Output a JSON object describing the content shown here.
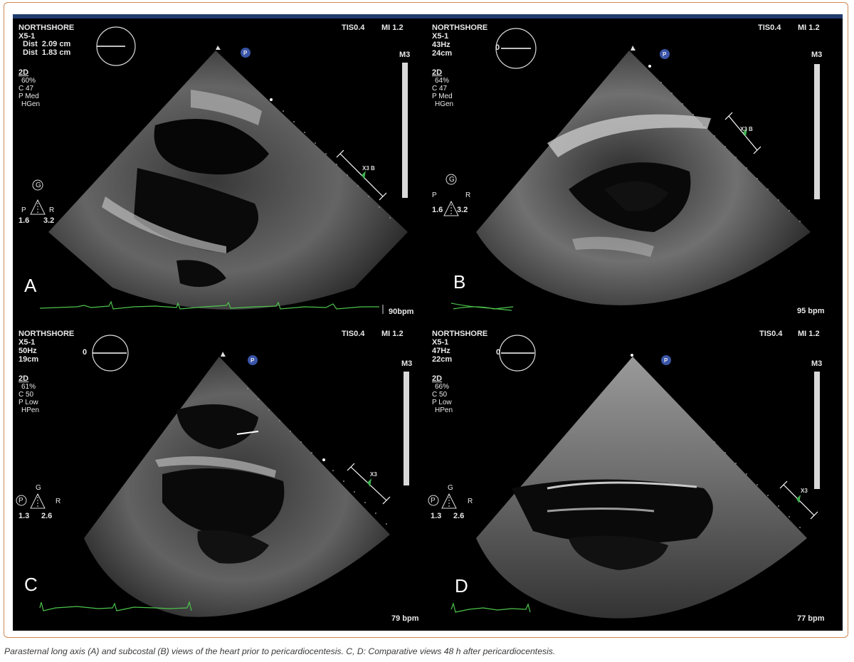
{
  "caption": "Parasternal long axis (A) and subcostal (B) views of the heart prior to pericardiocentesis. C, D: Comparative views 48 h after pericardiocentesis.",
  "colors": {
    "frame_border": "#d08a52",
    "top_bar": "#1f3c6c",
    "ecg_trace": "#4cc44c",
    "marker_green": "#3fb34f",
    "probe_badge": "#3a55a8"
  },
  "panels": {
    "A": {
      "letter": "A",
      "site": "NORTHSHORE",
      "probe": "X5-1",
      "dist1": "Dist  2.09 cm",
      "dist2": "Dist  1.83 cm",
      "mode": "2D",
      "gain": "60%",
      "comp": "C 47",
      "power": "P Med",
      "harmonic": "HGen",
      "tis": "TIS0.4",
      "mi": "MI 1.2",
      "map": "M3",
      "probe_badge": "P",
      "g_label": "G",
      "p_label": "P",
      "r_label": "R",
      "g_left": "1.6",
      "g_right": "3.2",
      "bpm": "90bpm",
      "depth_marker": "X3 B"
    },
    "B": {
      "letter": "B",
      "site": "NORTHSHORE",
      "probe": "X5-1",
      "freq": "43Hz",
      "depth": "24cm",
      "angle": "0",
      "mode": "2D",
      "gain": "64%",
      "comp": "C 47",
      "power": "P Med",
      "harmonic": "HGen",
      "tis": "TIS0.4",
      "mi": "MI 1.2",
      "map": "M3",
      "probe_badge": "P",
      "g_label": "G",
      "p_label": "P",
      "r_label": "R",
      "g_left": "1.6",
      "g_right": "3.2",
      "bpm": "95 bpm",
      "depth_marker": "X3 B"
    },
    "C": {
      "letter": "C",
      "site": "NORTHSHORE",
      "probe": "X5-1",
      "freq": "50Hz",
      "depth": "19cm",
      "angle": "0",
      "mode": "2D",
      "gain": "61%",
      "comp": "C 50",
      "power": "P Low",
      "harmonic": "HPen",
      "tis": "TIS0.4",
      "mi": "MI 1.2",
      "map": "M3",
      "probe_badge": "P",
      "g_label": "G",
      "p_label": "P",
      "r_label": "R",
      "g_left": "1.3",
      "g_right": "2.6",
      "bpm": "79 bpm",
      "depth_marker": "X3"
    },
    "D": {
      "letter": "D",
      "site": "NORTHSHORE",
      "probe": "X5-1",
      "freq": "47Hz",
      "depth": "22cm",
      "angle": "0",
      "mode": "2D",
      "gain": "66%",
      "comp": "C 50",
      "power": "P Low",
      "harmonic": "HPen",
      "tis": "TIS0.4",
      "mi": "MI 1.2",
      "map": "M3",
      "probe_badge": "P",
      "g_label": "G",
      "p_label": "P",
      "r_label": "R",
      "g_left": "1.3",
      "g_right": "2.6",
      "bpm": "77 bpm",
      "depth_marker": "X3"
    }
  }
}
